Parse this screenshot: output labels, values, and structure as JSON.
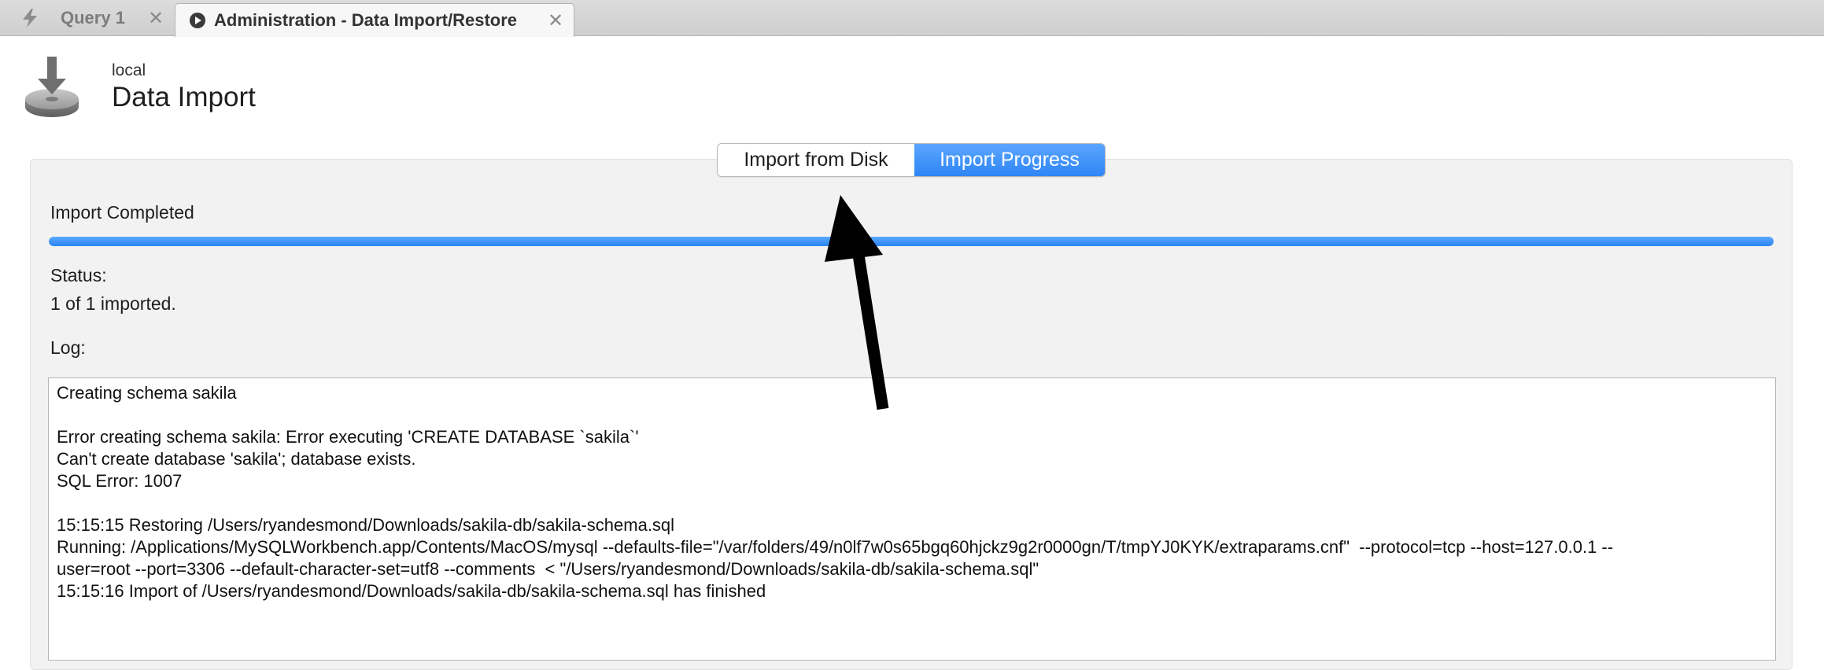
{
  "tabs": [
    {
      "label": "Query 1",
      "icon": "lightning-icon",
      "active": false
    },
    {
      "label": "Administration - Data Import/Restore",
      "icon": "play-circle-icon",
      "active": true
    }
  ],
  "tab_close_glyph": "✕",
  "header": {
    "connection": "local",
    "title": "Data Import",
    "icon": "import-disk-icon"
  },
  "segmented": {
    "items": [
      "Import from Disk",
      "Import Progress"
    ],
    "selected": "Import Progress"
  },
  "progress": {
    "heading": "Import Completed",
    "fraction": 1.0
  },
  "status": {
    "label": "Status:",
    "value": "1 of 1 imported."
  },
  "log": {
    "label": "Log:",
    "lines": [
      "Creating schema sakila",
      "",
      "Error creating schema sakila: Error executing 'CREATE DATABASE `sakila`'",
      "Can't create database 'sakila'; database exists.",
      "SQL Error: 1007",
      "",
      "15:15:15 Restoring /Users/ryandesmond/Downloads/sakila-db/sakila-schema.sql",
      "Running: /Applications/MySQLWorkbench.app/Contents/MacOS/mysql --defaults-file=\"/var/folders/49/n0lf7w0s65bgq60hjckz9g2r0000gn/T/tmpYJ0KYK/extraparams.cnf\"  --protocol=tcp --host=127.0.0.1 --",
      "user=root --port=3306 --default-character-set=utf8 --comments  < \"/Users/ryandesmond/Downloads/sakila-db/sakila-schema.sql\"",
      "15:15:16 Import of /Users/ryandesmond/Downloads/sakila-db/sakila-schema.sql has finished"
    ]
  },
  "colors": {
    "accent": "#2f86f5",
    "arrow": "#000000"
  }
}
